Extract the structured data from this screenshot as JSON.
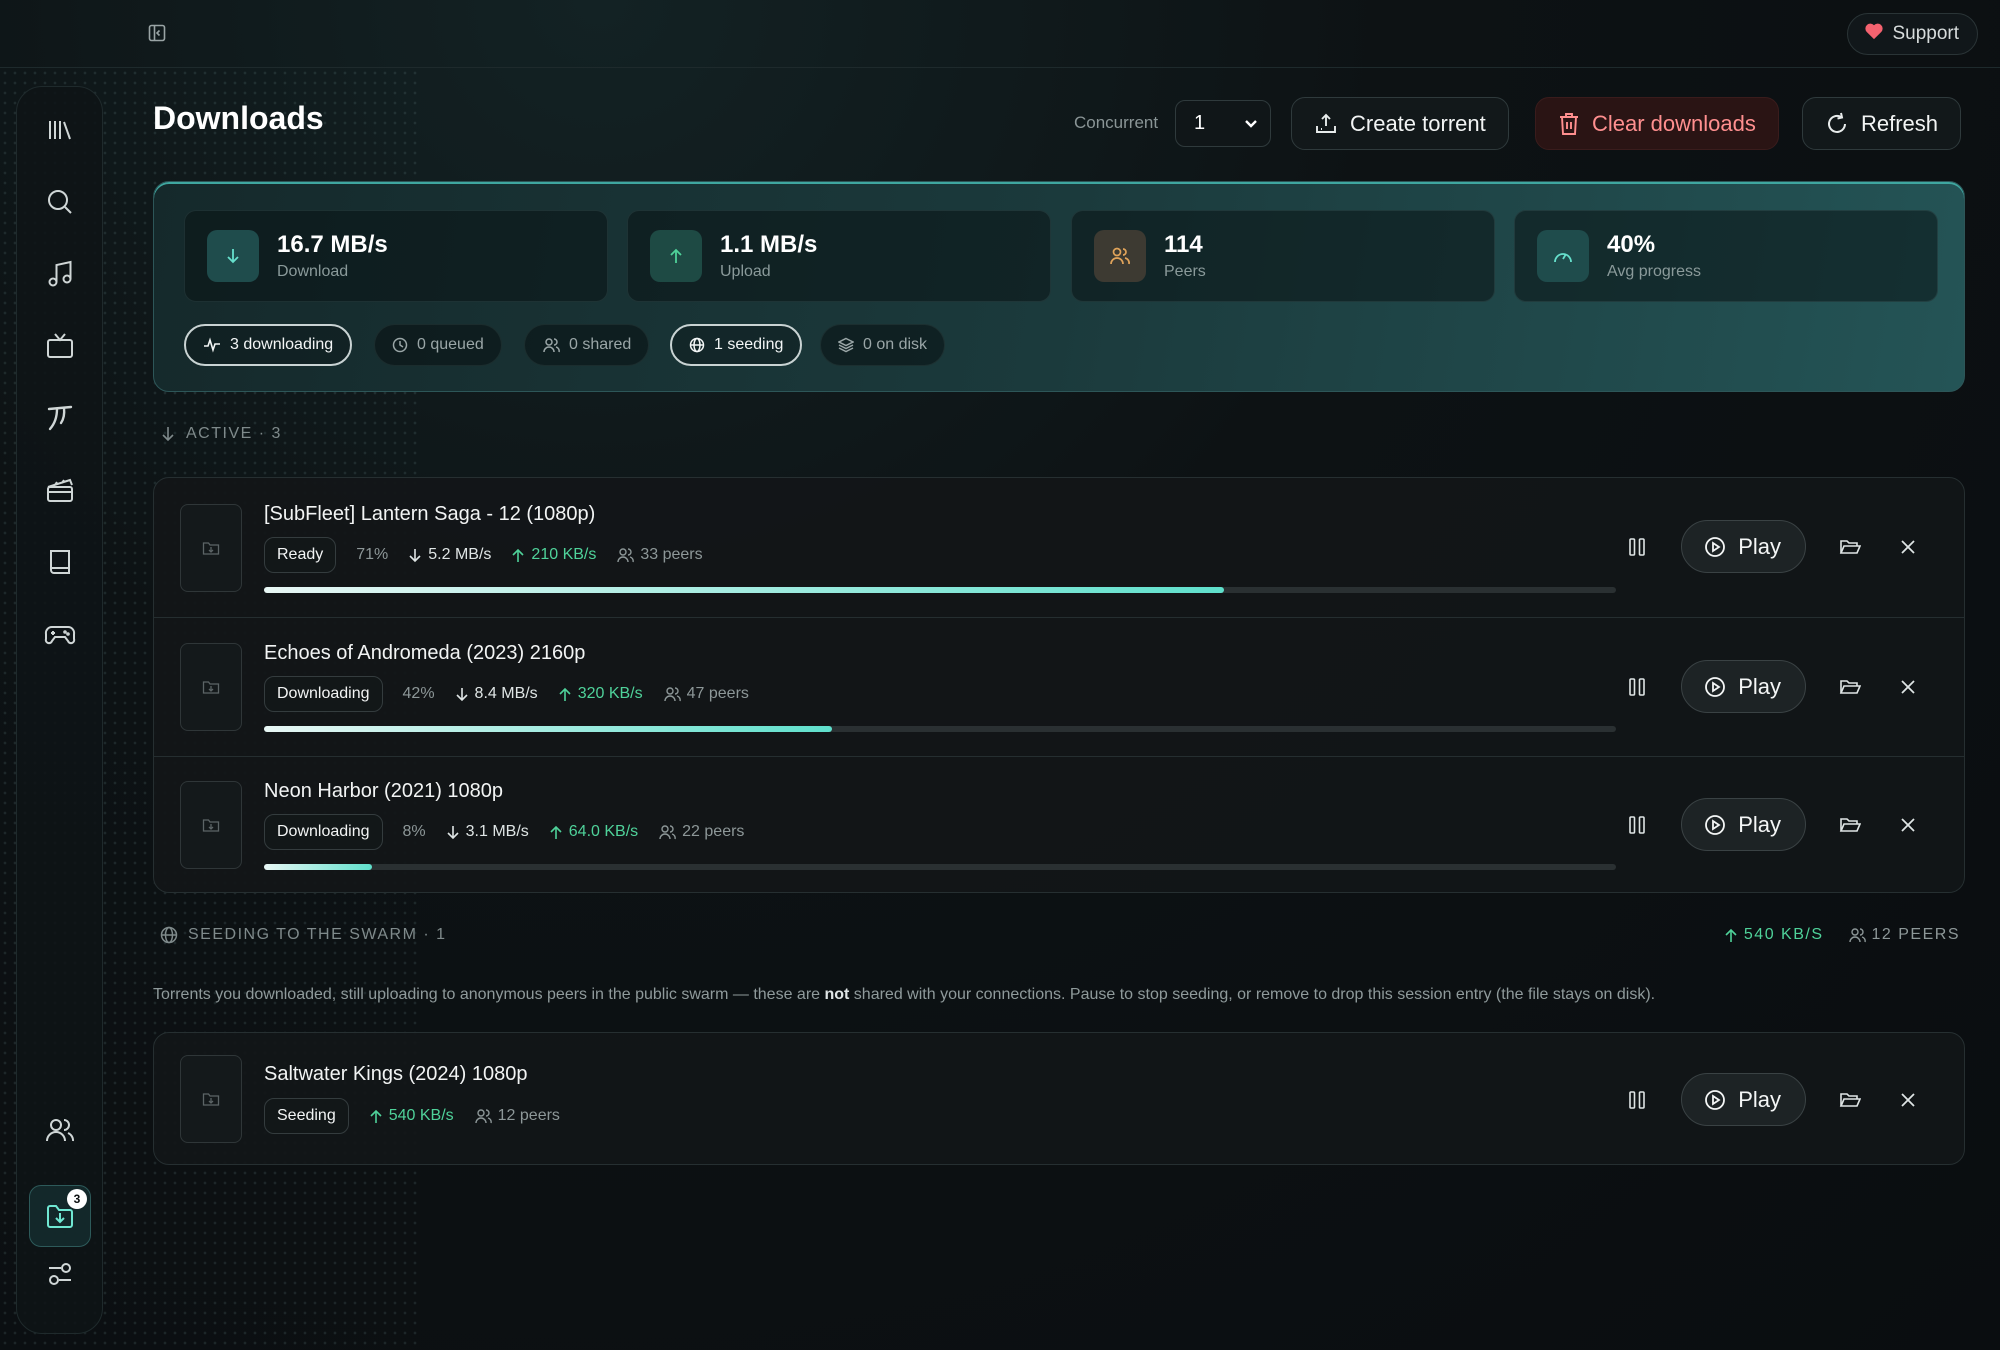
{
  "header": {
    "title": "Downloads",
    "concurrent_label": "Concurrent",
    "concurrent_value": "1",
    "create_torrent_label": "Create torrent",
    "clear_downloads_label": "Clear downloads",
    "refresh_label": "Refresh",
    "support_label": "Support"
  },
  "sidebar": {
    "items": [
      {
        "icon": "library-icon"
      },
      {
        "icon": "search-icon"
      },
      {
        "icon": "music-icon"
      },
      {
        "icon": "tv-icon"
      },
      {
        "icon": "anime-icon"
      },
      {
        "icon": "movies-icon"
      },
      {
        "icon": "book-icon"
      },
      {
        "icon": "gamepad-icon"
      }
    ],
    "bottom_items": [
      {
        "icon": "friends-icon"
      },
      {
        "icon": "downloads-icon",
        "badge": "3",
        "active": true
      },
      {
        "icon": "settings-sliders-icon"
      }
    ]
  },
  "stats": {
    "download": {
      "value": "16.7 MB/s",
      "label": "Download"
    },
    "upload": {
      "value": "1.1 MB/s",
      "label": "Upload"
    },
    "peers": {
      "value": "114",
      "label": "Peers"
    },
    "progress": {
      "value": "40%",
      "label": "Avg progress"
    }
  },
  "chips": {
    "downloading": "3 downloading",
    "queued": "0 queued",
    "shared": "0 shared",
    "seeding": "1 seeding",
    "on_disk": "0 on disk"
  },
  "active_section": {
    "label": "ACTIVE · 3"
  },
  "active": [
    {
      "title": "[SubFleet] Lantern Saga - 12 (1080p)",
      "status": "Ready",
      "percent": "71%",
      "progress": 0.71,
      "down": "5.2 MB/s",
      "up": "210 KB/s",
      "peers": "33 peers",
      "play": "Play"
    },
    {
      "title": "Echoes of Andromeda (2023) 2160p",
      "status": "Downloading",
      "percent": "42%",
      "progress": 0.42,
      "down": "8.4 MB/s",
      "up": "320 KB/s",
      "peers": "47 peers",
      "play": "Play"
    },
    {
      "title": "Neon Harbor (2021) 1080p",
      "status": "Downloading",
      "percent": "8%",
      "progress": 0.08,
      "down": "3.1 MB/s",
      "up": "64.0 KB/s",
      "peers": "22 peers",
      "play": "Play"
    }
  ],
  "seeding_section": {
    "label": "SEEDING TO THE SWARM · 1",
    "total_up": "540 KB/S",
    "total_peers": "12 PEERS",
    "note_before": "Torrents you downloaded, still uploading to anonymous peers in the public swarm — these are ",
    "note_bold": "not",
    "note_after": " shared with your connections. Pause to stop seeding, or remove to drop this session entry (the file stays on disk)."
  },
  "seeding": [
    {
      "title": "Saltwater Kings (2024) 1080p",
      "status": "Seeding",
      "up": "540 KB/s",
      "peers": "12 peers",
      "play": "Play"
    }
  ],
  "colors": {
    "accent": "#5fe0cc",
    "upload_green": "#4fd29a",
    "danger": "#ff8f8f",
    "peers_orange": "#e0a35a"
  }
}
